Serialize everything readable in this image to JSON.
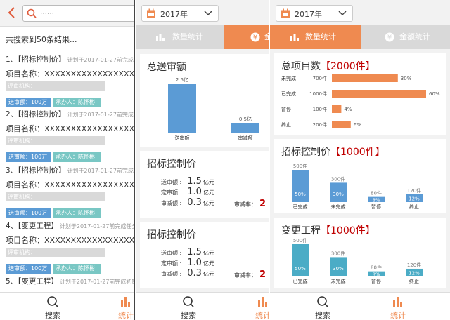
{
  "search_screen": {
    "placeholder": "……",
    "result_count": "共搜索到50条结果...",
    "items": [
      {
        "title": "1、【招标控制价】",
        "plan": "计划于2017-01-27前完成初审确认",
        "name": "项目名称：XXXXXXXXXXXXXXXXXXXXXXXXX",
        "org": "评审机构：XXXXXXXXXXXXXXXXXXX",
        "amount": "送审额：100万",
        "handler": "承办人：陈怀彬"
      },
      {
        "title": "2、【招标控制价】",
        "plan": "计划于2017-01-27前完成初审确认",
        "name": "项目名称：XXXXXXXXXXXXXXXXXXXXXXXXX",
        "org": "评审机构：XXXXXXXXXXXXXXXXXXX",
        "amount": "送审额：100万",
        "handler": "承办人：陈怀彬"
      },
      {
        "title": "3、【招标控制价】",
        "plan": "计划于2017-01-27前完成初审确认",
        "name": "项目名称：XXXXXXXXXXXXXXXXXXXXXXXXX",
        "org": "评审机构：XXXXXXXXXXXXXXXXXXX",
        "amount": "送审额：100万",
        "handler": "承办人：陈怀彬"
      },
      {
        "title": "4、【变更工程】",
        "plan": "计划于2017-01-27前完成任务分配",
        "name": "项目名称：XXXXXXXXXXXXXXXXXXXXXXXXX",
        "org": "评审机构：XXXXXXXXXXXXXXXXXXX",
        "amount": "送审额：100万",
        "handler": "承办人：陈怀彬"
      },
      {
        "title": "5、【变更工程】",
        "plan": "计划于2017-01-27前完成初审确认"
      }
    ]
  },
  "nav": {
    "search": "搜索",
    "stats": "统计"
  },
  "year": "2017年",
  "tabs": {
    "count": "数量统计",
    "amount": "金额统计",
    "amount_cut": "金"
  },
  "amount_screen": {
    "review_title": "总送审额",
    "review_chart": {
      "type": "bar",
      "categories": [
        "送审额",
        "审减额"
      ],
      "values": [
        2.5,
        0.5
      ],
      "value_labels": [
        "2.5亿",
        "0.5亿"
      ]
    },
    "sections": [
      {
        "title": "招标控制价",
        "rows": [
          {
            "label": "送审额 :",
            "value": "1.5",
            "unit": "亿元"
          },
          {
            "label": "定审额 :",
            "value": "1.0",
            "unit": "亿元"
          },
          {
            "label": "审减额 :",
            "value": "0.3",
            "unit": "亿元"
          }
        ],
        "rate_label": "审减率：",
        "rate_value": "2"
      },
      {
        "title": "招标控制价",
        "rows": [
          {
            "label": "送审额 :",
            "value": "1.5",
            "unit": "亿元"
          },
          {
            "label": "定审额 :",
            "value": "1.0",
            "unit": "亿元"
          },
          {
            "label": "审减额 :",
            "value": "0.3",
            "unit": "亿元"
          }
        ],
        "rate_label": "审减率：",
        "rate_value": "2"
      }
    ]
  },
  "count_screen": {
    "total": {
      "title": "总项目数",
      "count": "【2000件】"
    },
    "chart_data": [
      {
        "type": "bar",
        "orientation": "horizontal",
        "categories": [
          "未完成",
          "已完成",
          "暂停",
          "终止"
        ],
        "values": [
          700,
          1000,
          100,
          200
        ],
        "value_labels": [
          "700件",
          "1000件",
          "100件",
          "200件"
        ],
        "percent_labels": [
          "30%",
          "60%",
          "4%",
          "6%"
        ],
        "color": "#ef8a50"
      },
      {
        "type": "bar",
        "title": "招标控制价【1000件】",
        "categories": [
          "已完成",
          "未完成",
          "暂停",
          "终止"
        ],
        "values": [
          500,
          300,
          80,
          120
        ],
        "value_labels": [
          "500件",
          "300件",
          "80件",
          "120件"
        ],
        "percent_labels": [
          "50%",
          "30%",
          "8%",
          "12%"
        ],
        "color": "#5b9bd5"
      },
      {
        "type": "bar",
        "title": "变更工程【1000件】",
        "categories": [
          "已完成",
          "未完成",
          "暂停",
          "终止"
        ],
        "values": [
          500,
          300,
          80,
          120
        ],
        "value_labels": [
          "500件",
          "300件",
          "80件",
          "120件"
        ],
        "percent_labels": [
          "50%",
          "30%",
          "8%",
          "12%"
        ],
        "color": "#4bacc6"
      }
    ],
    "sections": [
      {
        "title": "招标控制价",
        "count": "【1000件】"
      },
      {
        "title": "变更工程",
        "count": "【1000件】"
      }
    ]
  },
  "colors": {
    "accent": "#ef8a50",
    "blue": "#5b9bd5",
    "teal": "#4bacc6",
    "red": "#c00000"
  }
}
